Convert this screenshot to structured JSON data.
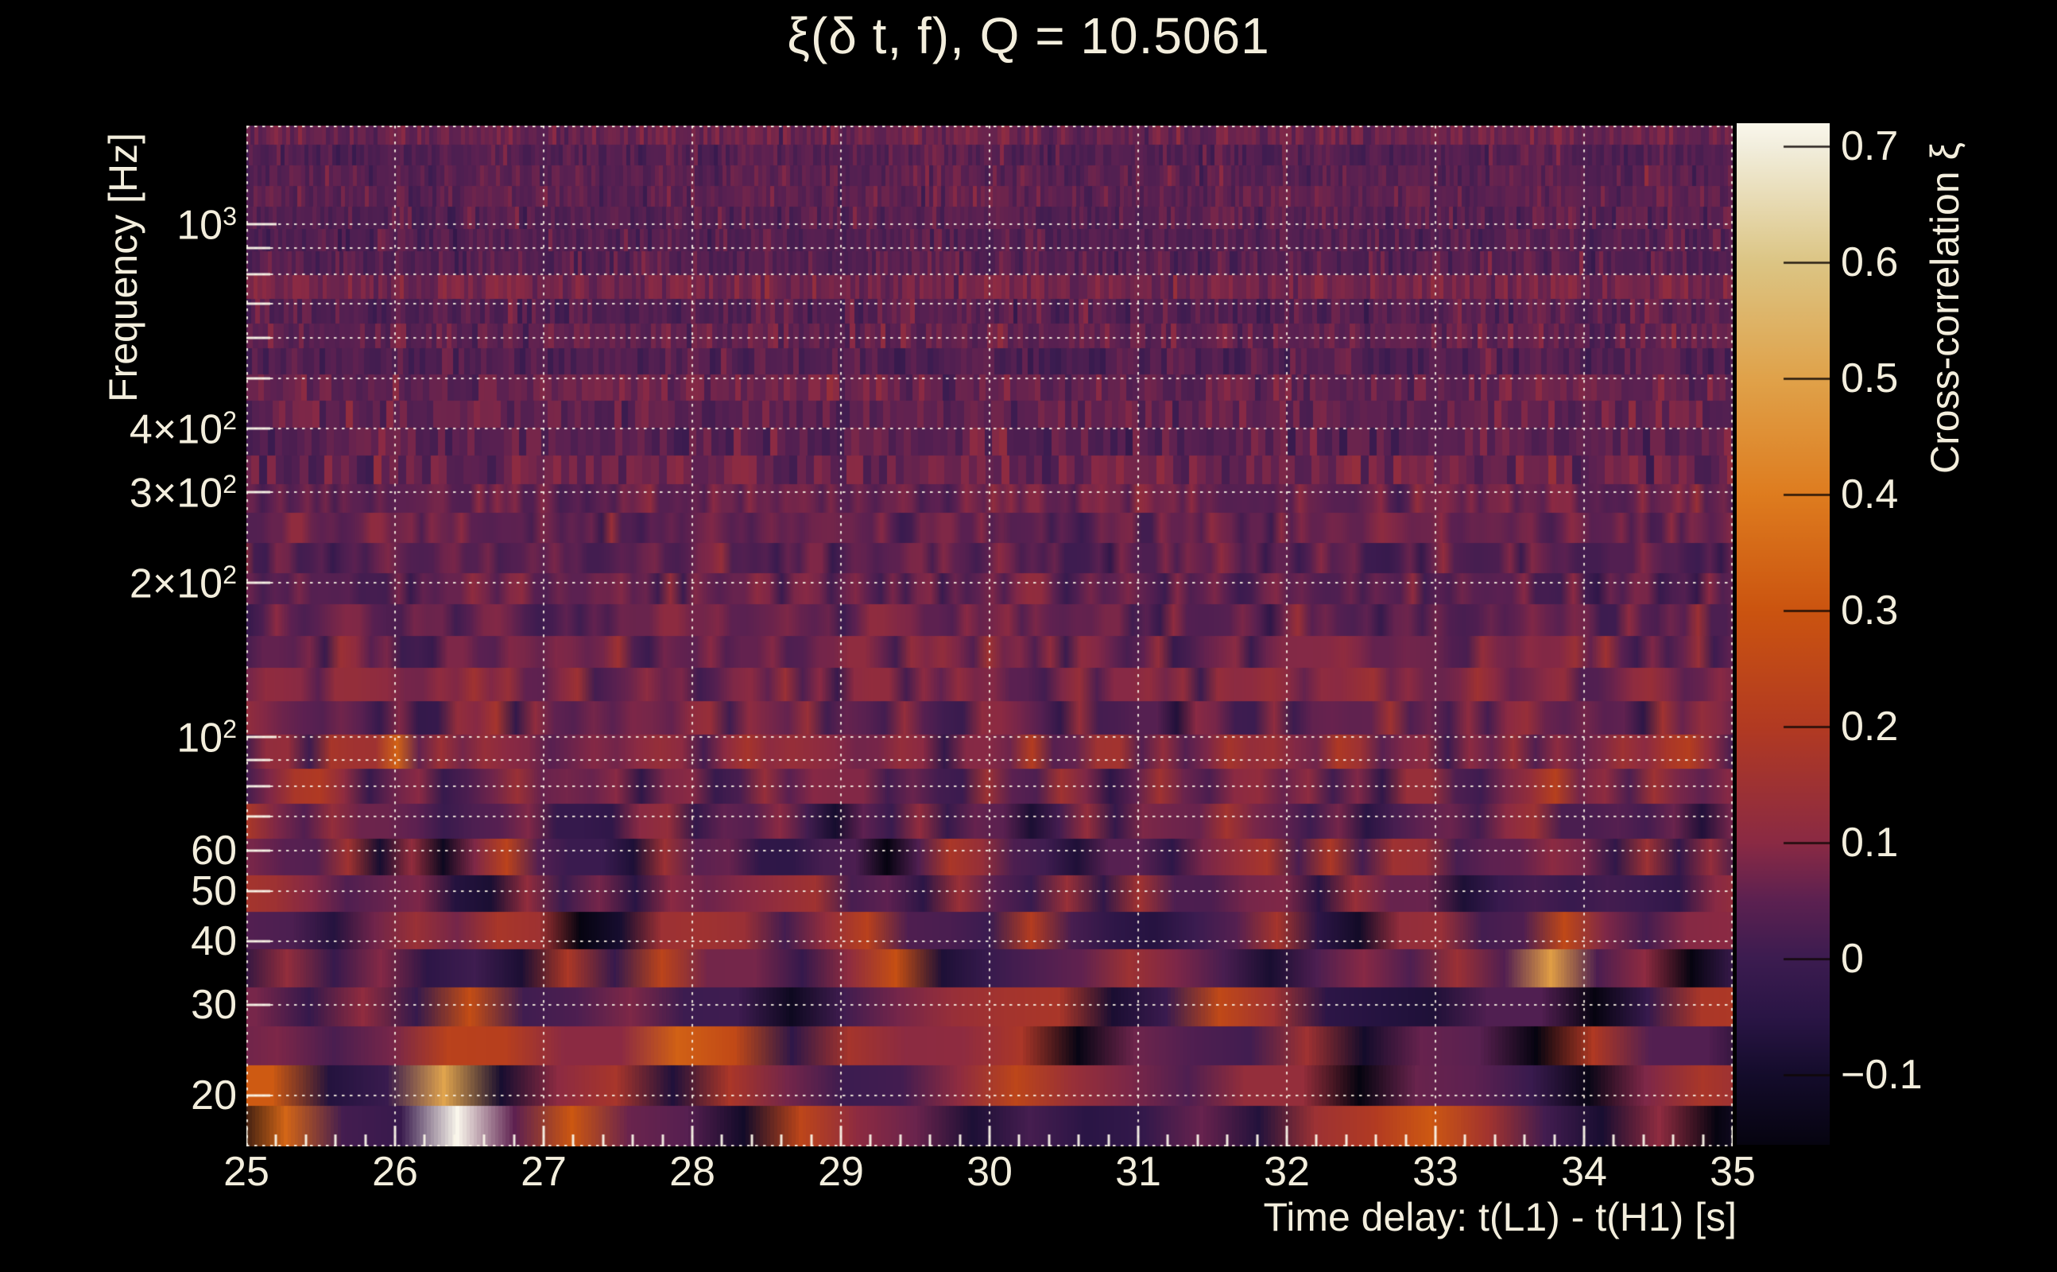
{
  "colors": {
    "background": "#000000",
    "text": "#f3eedd",
    "grid": "rgba(247,241,227,0.92)",
    "tick": "rgba(250,245,232,0.95)",
    "colorbar_tick": "rgba(15,8,5,0.9)"
  },
  "chart_data": {
    "type": "heatmap",
    "title": "ξ(δ t, f), Q = 10.5061",
    "xlabel": "Time delay: t(L1) - t(H1) [s]",
    "ylabel": "Frequency [Hz]",
    "colorbar_label": "Cross-correlation ξ",
    "x_range": [
      25,
      35
    ],
    "x_tick_labels": [
      "25",
      "26",
      "27",
      "28",
      "29",
      "30",
      "31",
      "32",
      "33",
      "34",
      "35"
    ],
    "x_minor_tick_step": 0.2,
    "x_gridlines": [
      26,
      27,
      28,
      29,
      30,
      31,
      32,
      33,
      34
    ],
    "y_scale": "log",
    "y_range_hz": [
      15.9,
      1557
    ],
    "y_tick_labels": [
      {
        "f": 1000,
        "text": "10",
        "sup": "3"
      },
      {
        "f": 400,
        "text": "4×10",
        "sup": "2"
      },
      {
        "f": 300,
        "text": "3×10",
        "sup": "2"
      },
      {
        "f": 200,
        "text": "2×10",
        "sup": "2"
      },
      {
        "f": 100,
        "text": "10",
        "sup": "2"
      },
      {
        "f": 60,
        "text": "60"
      },
      {
        "f": 50,
        "text": "50"
      },
      {
        "f": 40,
        "text": "40"
      },
      {
        "f": 30,
        "text": "30"
      },
      {
        "f": 20,
        "text": "20"
      }
    ],
    "y_gridline_freqs": [
      20,
      30,
      40,
      50,
      60,
      70,
      80,
      90,
      100,
      200,
      300,
      400,
      500,
      600,
      700,
      800,
      900,
      1000
    ],
    "grid": "dotted",
    "value_range": [
      -0.16,
      0.72
    ],
    "colorbar_ticks": [
      {
        "v": 0.7,
        "label": "0.7"
      },
      {
        "v": 0.6,
        "label": "0.6"
      },
      {
        "v": 0.5,
        "label": "0.5"
      },
      {
        "v": 0.4,
        "label": "0.4"
      },
      {
        "v": 0.3,
        "label": "0.3"
      },
      {
        "v": 0.2,
        "label": "0.2"
      },
      {
        "v": 0.1,
        "label": "0.1"
      },
      {
        "v": 0.0,
        "label": "0"
      },
      {
        "v": -0.1,
        "label": "−0.1"
      }
    ],
    "colormap_stops": [
      [
        0.0,
        "#060410"
      ],
      [
        0.068,
        "#140c2b"
      ],
      [
        0.125,
        "#2a1545"
      ],
      [
        0.182,
        "#3c1c50"
      ],
      [
        0.239,
        "#5c2151"
      ],
      [
        0.295,
        "#8a2a44"
      ],
      [
        0.409,
        "#b23a22"
      ],
      [
        0.523,
        "#cb5410"
      ],
      [
        0.636,
        "#de7c1f"
      ],
      [
        0.75,
        "#e0a24a"
      ],
      [
        0.864,
        "#dcc584"
      ],
      [
        0.977,
        "#f2eedd"
      ],
      [
        1.0,
        "#faf7ec"
      ]
    ],
    "noise": {
      "seed": 1337,
      "rows": 34,
      "row_weight_growth": 1.1,
      "profile": [
        [
          3.2,
          0.05,
          0.016
        ],
        [
          2.7,
          0.05,
          0.022
        ],
        [
          2.3,
          0.048,
          0.034
        ],
        [
          2.0,
          0.052,
          0.048
        ],
        [
          1.9,
          0.07,
          0.06
        ],
        [
          1.78,
          0.055,
          0.075
        ],
        [
          1.6,
          0.055,
          0.095
        ],
        [
          1.45,
          0.042,
          0.105
        ],
        [
          1.3,
          0.048,
          0.11
        ],
        [
          1.19,
          0.05,
          0.1
        ]
      ],
      "column_stripe_amp": 0.022,
      "row_mu_jitter": 0.012,
      "tile_width_coef": 950,
      "tile_width_exp": 0.78,
      "tile_width_min": 5,
      "tile_width_max": 72
    },
    "hotspots": [
      [
        26.36,
        16.3,
        0.85,
        0.09,
        0.05
      ],
      [
        26.33,
        21.5,
        0.3,
        0.11,
        0.05
      ],
      [
        25.3,
        20.5,
        0.24,
        0.12,
        0.055
      ],
      [
        27.15,
        17.0,
        0.32,
        0.1,
        0.05
      ],
      [
        27.15,
        31.0,
        0.2,
        0.07,
        0.05
      ],
      [
        26.6,
        30.0,
        0.22,
        0.08,
        0.05
      ],
      [
        28.05,
        19.5,
        0.16,
        0.1,
        0.05
      ],
      [
        29.15,
        39.0,
        0.34,
        0.07,
        0.055
      ],
      [
        29.38,
        30.0,
        0.27,
        0.08,
        0.05
      ],
      [
        29.6,
        16.5,
        0.22,
        0.09,
        0.05
      ],
      [
        30.1,
        25.0,
        0.27,
        0.1,
        0.06
      ],
      [
        30.38,
        26.5,
        0.2,
        0.08,
        0.05
      ],
      [
        31.35,
        19.0,
        0.18,
        0.1,
        0.05
      ],
      [
        32.05,
        30.0,
        0.32,
        0.06,
        0.09
      ],
      [
        33.05,
        16.2,
        0.34,
        0.11,
        0.05
      ],
      [
        33.78,
        36.5,
        0.38,
        0.08,
        0.06
      ],
      [
        34.5,
        20.5,
        0.2,
        0.09,
        0.05
      ],
      [
        34.85,
        30.5,
        0.3,
        0.08,
        0.06
      ],
      [
        26.0,
        93.0,
        0.16,
        0.045,
        0.045
      ],
      [
        33.55,
        105.0,
        0.18,
        0.05,
        0.04
      ],
      [
        34.75,
        95.0,
        0.14,
        0.05,
        0.04
      ],
      [
        25.55,
        88.0,
        0.12,
        0.05,
        0.04
      ],
      [
        26.75,
        62.0,
        0.15,
        0.05,
        0.045
      ],
      [
        29.9,
        47.0,
        0.15,
        0.06,
        0.045
      ],
      [
        31.05,
        52.0,
        0.12,
        0.06,
        0.045
      ],
      [
        28.4,
        42.0,
        0.13,
        0.06,
        0.045
      ],
      [
        33.65,
        55.0,
        0.13,
        0.06,
        0.045
      ]
    ]
  }
}
